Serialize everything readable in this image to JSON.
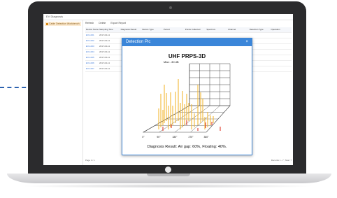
{
  "window": {
    "title": "EV Diagnosis"
  },
  "sidebar": {
    "items": [
      {
        "label": "Cable Detection Workbench"
      }
    ]
  },
  "toolbar": {
    "items": [
      "Refresh",
      "Delete",
      "Export Report"
    ]
  },
  "table": {
    "columns": [
      "Device Name",
      "Sampling Time",
      "Diagnosis Result",
      "Device Type",
      "Period",
      "Points Collected",
      "Spectrum",
      "Channel",
      "Detection Type",
      "Operation"
    ],
    "rows": [
      [
        "EV1-001",
        "2017-04-11",
        "",
        "",
        "",
        "",
        "",
        "",
        "",
        ""
      ],
      [
        "EV1-002",
        "2017-04-11",
        "",
        "",
        "",
        "",
        "",
        "",
        "",
        ""
      ],
      [
        "EV1-003",
        "2017-04-11",
        "",
        "",
        "",
        "",
        "",
        "",
        "",
        ""
      ],
      [
        "EV1-004",
        "2017-04-11",
        "",
        "",
        "",
        "",
        "",
        "",
        "",
        ""
      ],
      [
        "EV1-005",
        "2017-04-11",
        "",
        "",
        "",
        "",
        "",
        "",
        "",
        ""
      ],
      [
        "EV1-006",
        "2017-04-11",
        "",
        "",
        "",
        "",
        "",
        "",
        "",
        ""
      ],
      [
        "EV1-007",
        "2017-04-11",
        "",
        "",
        "",
        "",
        "",
        "",
        "",
        ""
      ]
    ]
  },
  "pager": {
    "left": "Page 1 / 1",
    "right": "Records 1 - 7, Total: 7"
  },
  "modal": {
    "title": "Detection Pic",
    "close": "×",
    "diagnosis": "Diagnosis Result: Air gap: 60%, Floating: 40%."
  },
  "chart_data": {
    "type": "bar",
    "title": "UHF PRPS-3D",
    "subtitle": "Max: -30 dB",
    "x_ticks": [
      "0°",
      "90°",
      "180°",
      "270°",
      "360°"
    ],
    "colors": {
      "bar": "#f2b736",
      "bar_hot": "#e03b2a",
      "grid": "#444444"
    }
  },
  "colors": {
    "accent": "#3b86d9",
    "laptop": "#2b2b2d",
    "dash": "#2d62b0"
  }
}
